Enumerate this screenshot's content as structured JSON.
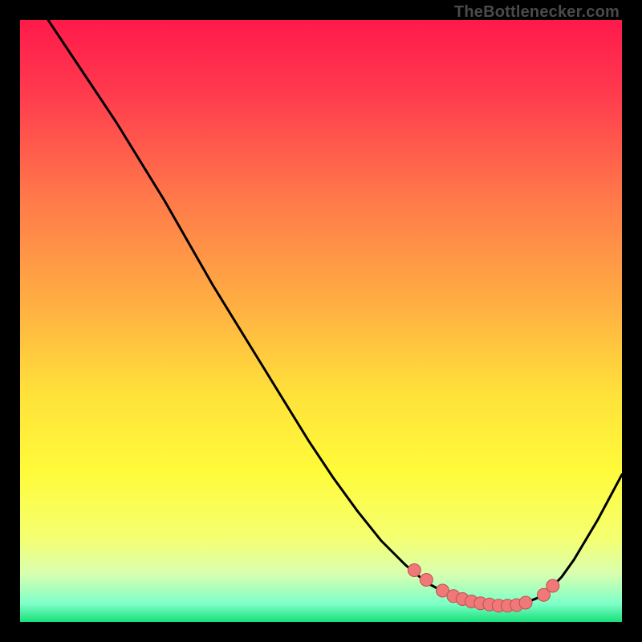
{
  "attribution": "TheBottlenecker.com",
  "colors": {
    "frame": "#000000",
    "curve": "#000000",
    "marker_fill": "#f07878",
    "marker_stroke": "#c05050",
    "gradient_stops": [
      {
        "offset": "0%",
        "color": "#ff1a4b"
      },
      {
        "offset": "12%",
        "color": "#ff3a4e"
      },
      {
        "offset": "30%",
        "color": "#ff7a4a"
      },
      {
        "offset": "48%",
        "color": "#ffb142"
      },
      {
        "offset": "62%",
        "color": "#ffe13a"
      },
      {
        "offset": "75%",
        "color": "#fffb3a"
      },
      {
        "offset": "86%",
        "color": "#f5ff70"
      },
      {
        "offset": "92%",
        "color": "#d8ffb0"
      },
      {
        "offset": "97%",
        "color": "#7dffc8"
      },
      {
        "offset": "100%",
        "color": "#18e07a"
      }
    ]
  },
  "chart_data": {
    "type": "line",
    "title": "",
    "xlabel": "",
    "ylabel": "",
    "xlim": [
      0,
      100
    ],
    "ylim": [
      0,
      100
    ],
    "grid": false,
    "series": [
      {
        "name": "bottleneck-curve",
        "x": [
          0,
          4,
          8,
          12,
          16,
          20,
          24,
          28,
          32,
          36,
          40,
          44,
          48,
          52,
          56,
          60,
          64,
          66,
          68,
          70,
          72,
          74,
          76,
          78,
          80,
          82,
          84,
          86,
          88,
          90,
          92,
          96,
          100
        ],
        "y": [
          108,
          101,
          95,
          89,
          83,
          76.5,
          70,
          63,
          56,
          49.5,
          43,
          36.5,
          30,
          24,
          18.5,
          13.5,
          9.5,
          7.8,
          6.3,
          5.2,
          4.3,
          3.6,
          3.1,
          2.8,
          2.7,
          2.8,
          3.2,
          4.0,
          5.4,
          7.5,
          10.3,
          17.0,
          24.5
        ]
      }
    ],
    "markers": {
      "name": "highlighted-points",
      "x": [
        65.5,
        67.5,
        70.2,
        72.0,
        73.5,
        75.0,
        76.5,
        78.0,
        79.5,
        81.0,
        82.5,
        84.0,
        87.0,
        88.5
      ],
      "y": [
        8.6,
        7.0,
        5.2,
        4.3,
        3.8,
        3.4,
        3.1,
        2.9,
        2.7,
        2.7,
        2.8,
        3.2,
        4.5,
        6.0
      ]
    }
  }
}
